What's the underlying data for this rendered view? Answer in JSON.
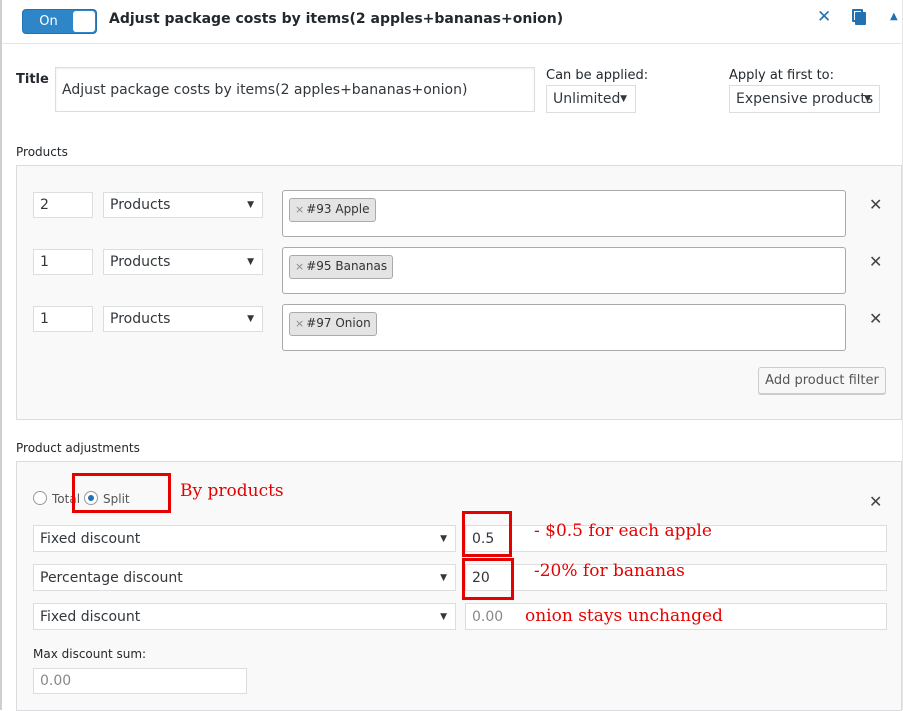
{
  "header": {
    "toggle_label": "On",
    "rule_title": "Adjust package costs by items(2 apples+bananas+onion)",
    "icons": {
      "close": "close-icon",
      "copy": "copy-icon",
      "collapse": "chevron-up-icon"
    }
  },
  "rule": {
    "title_label": "Title",
    "title_value": "Adjust package costs by items(2 apples+bananas+onion)",
    "can_be_applied_label": "Can be applied:",
    "can_be_applied_value": "Unlimited",
    "apply_first_label": "Apply at first to:",
    "apply_first_value": "Expensive products"
  },
  "products": {
    "section_label": "Products",
    "rows": [
      {
        "qty": "2",
        "type": "Products",
        "tag": "#93 Apple"
      },
      {
        "qty": "1",
        "type": "Products",
        "tag": "#95 Bananas"
      },
      {
        "qty": "1",
        "type": "Products",
        "tag": "#97 Onion"
      }
    ],
    "tag_remove": "×",
    "add_filter_label": "Add product filter"
  },
  "adjustments": {
    "section_label": "Product adjustments",
    "mode_total": "Total",
    "mode_split": "Split",
    "rows": [
      {
        "type": "Fixed discount",
        "value": "0.5",
        "placeholder": ""
      },
      {
        "type": "Percentage discount",
        "value": "20",
        "placeholder": ""
      },
      {
        "type": "Fixed discount",
        "value": "",
        "placeholder": "0.00"
      }
    ],
    "max_discount_label": "Max discount sum:",
    "max_discount_placeholder": "0.00"
  },
  "annotations": {
    "by_products": "By products",
    "apple": "- $0.5 for each apple",
    "bananas": "-20% for bananas",
    "onion": "onion stays unchanged"
  },
  "colors": {
    "accent": "#2271b1",
    "annotation": "#e60000"
  }
}
